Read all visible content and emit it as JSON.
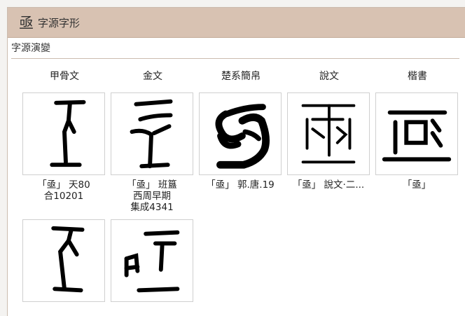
{
  "header": {
    "glyph": "亟",
    "title": "字源字形"
  },
  "section": {
    "title": "字源演變"
  },
  "columns": [
    "甲骨文",
    "金文",
    "楚系簡帛",
    "說文",
    "楷書"
  ],
  "items": [
    {
      "icon": "oracle-glyph-icon",
      "lines": [
        "「亟」 天80",
        "合10201"
      ]
    },
    {
      "icon": "bronze-glyph-icon",
      "lines": [
        "「亟」 班簋",
        "西周早期",
        "集成4341"
      ]
    },
    {
      "icon": "bamboo-glyph-icon",
      "lines": [
        "「亟」 郭.唐.19"
      ]
    },
    {
      "icon": "shuowen-glyph-icon",
      "lines": [
        "「亟」 說文‧二..."
      ]
    },
    {
      "icon": "kaishu-glyph-icon",
      "lines": [
        "「亟」"
      ]
    },
    {
      "icon": "oracle-variant-glyph-icon",
      "lines": []
    },
    {
      "icon": "bronze-variant-glyph-icon",
      "lines": []
    }
  ]
}
